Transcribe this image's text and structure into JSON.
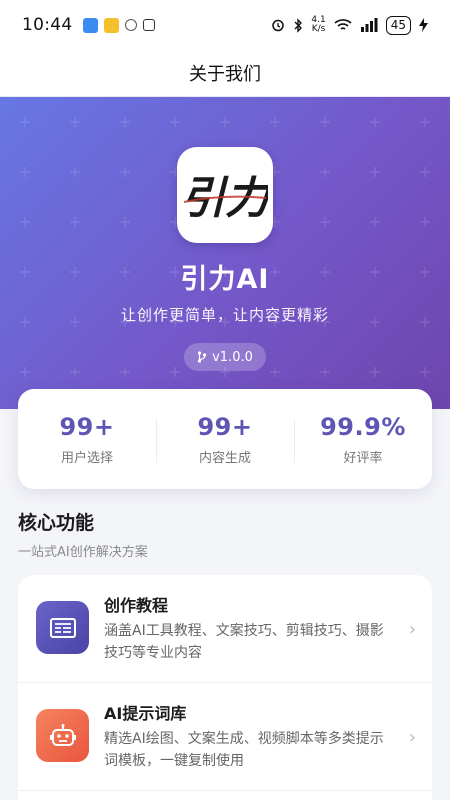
{
  "status_bar": {
    "time": "10:44",
    "net_speed_top": "4.1",
    "net_speed_bottom": "K/s",
    "battery": "45"
  },
  "nav": {
    "title": "关于我们"
  },
  "hero": {
    "logo_text": "引力",
    "app_name": "引力AI",
    "tagline": "让创作更简单，让内容更精彩",
    "version": "v1.0.0"
  },
  "stats": [
    {
      "value": "99+",
      "label": "用户选择"
    },
    {
      "value": "99+",
      "label": "内容生成"
    },
    {
      "value": "99.9%",
      "label": "好评率"
    }
  ],
  "section": {
    "title": "核心功能",
    "subtitle": "一站式AI创作解决方案"
  },
  "features": [
    {
      "title": "创作教程",
      "desc": "涵盖AI工具教程、文案技巧、剪辑技巧、摄影技巧等专业内容",
      "icon": "book-icon",
      "color": "#5b54b8"
    },
    {
      "title": "AI提示词库",
      "desc": "精选AI绘图、文案生成、视频脚本等多类提示词模板，一键复制使用",
      "icon": "robot-icon",
      "color": "#f06a50"
    }
  ],
  "colors": {
    "accent": "#5f56b3",
    "hero_start": "#6677e4",
    "hero_end": "#6e45ad"
  }
}
